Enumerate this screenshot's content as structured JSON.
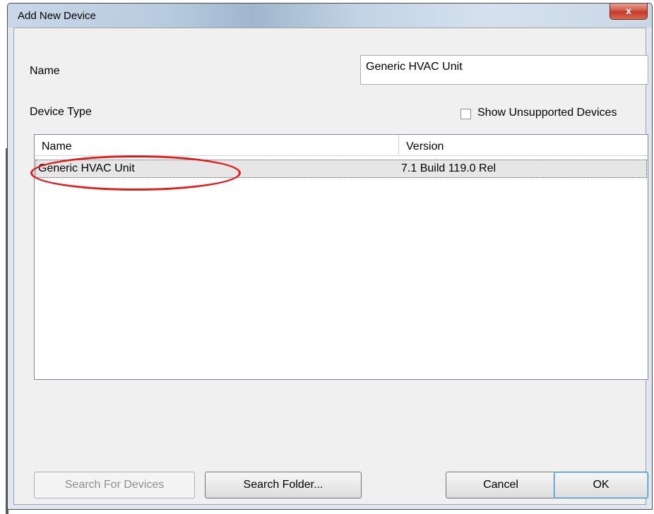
{
  "window": {
    "title": "Add New Device",
    "close_label": "x"
  },
  "name_field": {
    "label": "Name",
    "value": "Generic HVAC Unit"
  },
  "device_type": {
    "label": "Device Type",
    "show_unsupported": {
      "label": "Show Unsupported Devices",
      "checked": false
    }
  },
  "device_list": {
    "columns": [
      "Name",
      "Version"
    ],
    "rows": [
      {
        "name": "Generic HVAC Unit",
        "version": "7.1 Build 119.0 Rel",
        "selected": true,
        "highlighted": true
      }
    ]
  },
  "buttons": {
    "search_devices": "Search For Devices",
    "search_folder": "Search Folder...",
    "cancel": "Cancel",
    "ok": "OK"
  },
  "annotation": {
    "color": "#e21a1a"
  }
}
